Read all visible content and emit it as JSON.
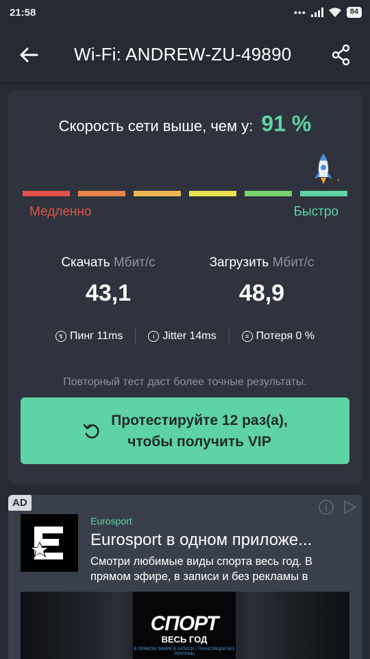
{
  "status_bar": {
    "time": "21:58",
    "dots": "•••",
    "battery": "84"
  },
  "header": {
    "title": "Wi-Fi: ANDREW-ZU-49890",
    "back_icon": "arrow-left-icon",
    "share_icon": "share-icon"
  },
  "result": {
    "faster_label": "Скорость сети выше, чем у:",
    "faster_value": "91 %",
    "faster_percent": 91,
    "scale_colors": [
      "#e0534c",
      "#e8864a",
      "#ecb654",
      "#e9e252",
      "#7ad46d",
      "#5fd3a5"
    ],
    "slow_label": "Медленно",
    "fast_label": "Быстро"
  },
  "metrics": {
    "download": {
      "label": "Скачать",
      "unit": "Мбит/с",
      "value": "43,1"
    },
    "upload": {
      "label": "Загрузить",
      "unit": "Мбит/с",
      "value": "48,9"
    }
  },
  "stats": {
    "ping": "Пинг 11ms",
    "jitter": "Jitter 14ms",
    "loss": "Потеря 0 %"
  },
  "hint": "Повторный тест даст более точные результаты.",
  "vip_button": {
    "line1": "Протестируйте 12 раз(а),",
    "line2": "чтобы получить VIP"
  },
  "ad": {
    "badge": "AD",
    "brand": "Eurosport",
    "title": "Eurosport в одном приложе...",
    "description": "Смотри любимые виды спорта весь год. В прямом эфире, в записи и без рекламы в",
    "poster_title": "СПОРТ",
    "poster_subtitle": "ВЕСЬ ГОД",
    "poster_small": "В ПРЯМОМ ЭФИРЕ В ЗАПИСИ І ТРАНСЛЯЦИИ БЕЗ РЕКЛАМЫ"
  },
  "colors": {
    "accent": "#5fd3a5",
    "slow": "#e0534c",
    "background": "#252a33",
    "card": "#2e333d"
  }
}
